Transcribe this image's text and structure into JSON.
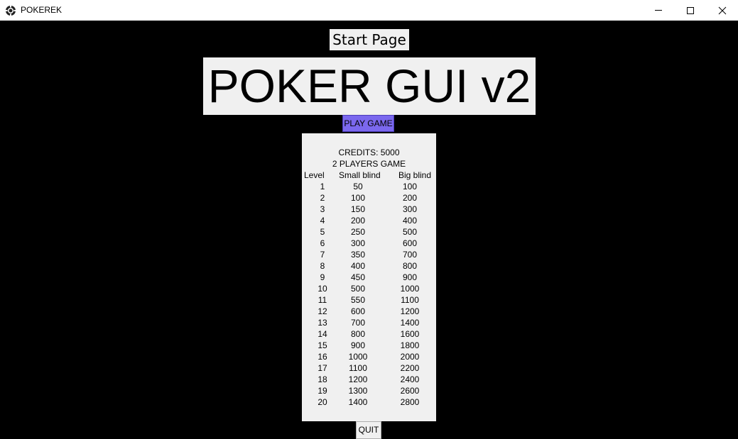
{
  "window": {
    "title": "POKEREK",
    "icon": "poker-chip-icon",
    "controls": [
      "minimize-icon",
      "maximize-icon",
      "close-icon"
    ]
  },
  "start_label": "Start Page",
  "main_title": "POKER GUI v2",
  "play_button": "PLAY GAME",
  "accent_color": "#7b68ee",
  "info": {
    "credits": "CREDITS: 5000",
    "mode": "2 PLAYERS GAME",
    "headers": {
      "level": "Level",
      "small": "Small blind",
      "big": "Big blind"
    },
    "rows": [
      {
        "level": "1",
        "small": "50",
        "big": "100"
      },
      {
        "level": "2",
        "small": "100",
        "big": "200"
      },
      {
        "level": "3",
        "small": "150",
        "big": "300"
      },
      {
        "level": "4",
        "small": "200",
        "big": "400"
      },
      {
        "level": "5",
        "small": "250",
        "big": "500"
      },
      {
        "level": "6",
        "small": "300",
        "big": "600"
      },
      {
        "level": "7",
        "small": "350",
        "big": "700"
      },
      {
        "level": "8",
        "small": "400",
        "big": "800"
      },
      {
        "level": "9",
        "small": "450",
        "big": "900"
      },
      {
        "level": "10",
        "small": "500",
        "big": "1000"
      },
      {
        "level": "11",
        "small": "550",
        "big": "1100"
      },
      {
        "level": "12",
        "small": "600",
        "big": "1200"
      },
      {
        "level": "13",
        "small": "700",
        "big": "1400"
      },
      {
        "level": "14",
        "small": "800",
        "big": "1600"
      },
      {
        "level": "15",
        "small": "900",
        "big": "1800"
      },
      {
        "level": "16",
        "small": "1000",
        "big": "2000"
      },
      {
        "level": "17",
        "small": "1100",
        "big": "2200"
      },
      {
        "level": "18",
        "small": "1200",
        "big": "2400"
      },
      {
        "level": "19",
        "small": "1300",
        "big": "2600"
      },
      {
        "level": "20",
        "small": "1400",
        "big": "2800"
      }
    ]
  },
  "quit_button": "QUIT"
}
